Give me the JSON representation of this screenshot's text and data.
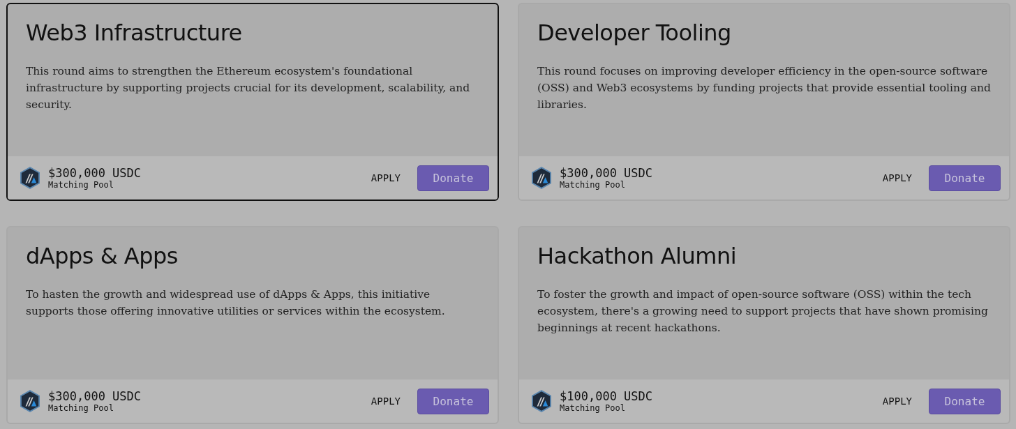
{
  "rounds": [
    {
      "title": "Web3 Infrastructure",
      "description": "This round aims to strengthen the Ethereum ecosystem's foundational infrastructure by supporting projects crucial for its development, scalability, and security.",
      "amount": "$300,000 USDC",
      "pool_label": "Matching Pool",
      "apply": "APPLY",
      "donate": "Donate",
      "selected": true
    },
    {
      "title": "Developer Tooling",
      "description": "This round focuses on improving developer efficiency in the open-source software (OSS) and Web3 ecosystems by funding projects that provide essential tooling and libraries.",
      "amount": "$300,000 USDC",
      "pool_label": "Matching Pool",
      "apply": "APPLY",
      "donate": "Donate",
      "selected": false
    },
    {
      "title": "dApps & Apps",
      "description": "To hasten the growth and widespread use of dApps & Apps, this initiative supports those offering innovative utilities or services within the ecosystem.",
      "amount": "$300,000 USDC",
      "pool_label": "Matching Pool",
      "apply": "APPLY",
      "donate": "Donate",
      "selected": false
    },
    {
      "title": "Hackathon Alumni",
      "description": "To foster the growth and impact of open-source software (OSS) within the tech ecosystem, there's a growing need to support projects that have shown promising beginnings at recent hackathons.",
      "amount": "$100,000 USDC",
      "pool_label": "Matching Pool",
      "apply": "APPLY",
      "donate": "Donate",
      "selected": false
    }
  ]
}
